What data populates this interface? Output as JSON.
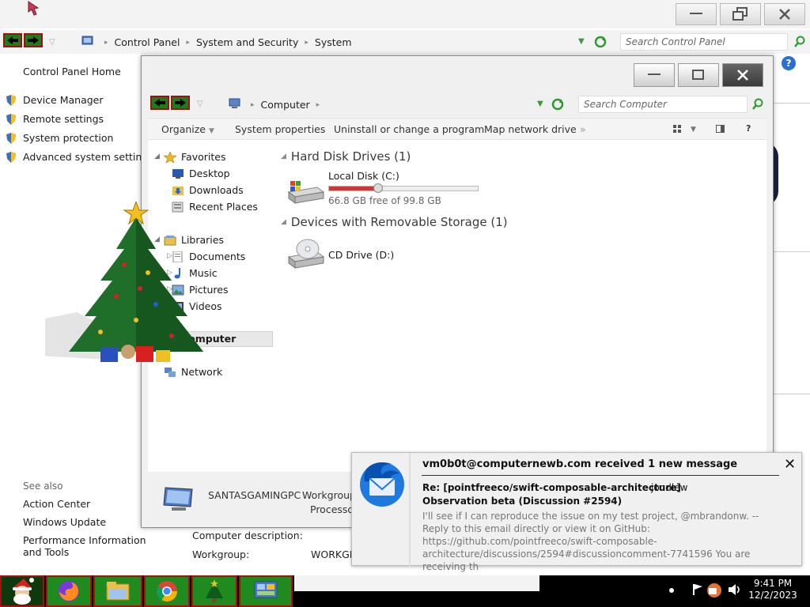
{
  "control_panel": {
    "breadcrumb": [
      "Control Panel",
      "System and Security",
      "System"
    ],
    "search_placeholder": "Search Control Panel",
    "home_link": "Control Panel Home",
    "tasks": [
      "Device Manager",
      "Remote settings",
      "System protection",
      "Advanced system settings"
    ],
    "see_also_label": "See also",
    "see_also": [
      "Action Center",
      "Windows Update",
      "Performance Information and Tools"
    ],
    "computer_description_label": "Computer description:",
    "workgroup_label": "Workgroup:",
    "workgroup_value": "WORKGR"
  },
  "explorer": {
    "location": "Computer",
    "search_placeholder": "Search Computer",
    "toolbar": [
      "Organize",
      "System properties",
      "Uninstall or change a program",
      "Map network drive"
    ],
    "help_label": "?",
    "nav": {
      "favorites": "Favorites",
      "favorites_items": [
        "Desktop",
        "Downloads",
        "Recent Places"
      ],
      "libraries": "Libraries",
      "libraries_items": [
        "Documents",
        "Music",
        "Pictures",
        "Videos"
      ],
      "computer": "Computer",
      "network": "Network"
    },
    "groups": {
      "hdd_title": "Hard Disk Drives (1)",
      "removable_title": "Devices with Removable Storage (1)"
    },
    "drives": {
      "c_name": "Local Disk (C:)",
      "c_free": "66.8 GB free of 99.8 GB",
      "c_used_fraction": 0.33,
      "d_name": "CD Drive (D:)"
    },
    "details": {
      "computer_name": "SANTASGAMINGPC",
      "workgroup": "Workgroup",
      "processor": "Processor"
    }
  },
  "notification": {
    "header": "vm0b0t@computernewb.com received 1 new message",
    "subject_line1": "Re: [pointfreeco/swift-composable-architecture]",
    "sender": "jondlew",
    "subject_line2": "Observation beta (Discussion #2594)",
    "body": "I'll see if I can reproduce the issue on my test project, @mbrandonw. -- Reply to this email directly or view it on GitHub: https://github.com/pointfreeco/swift-composable-architecture/discussions/2594#discussioncomment-7741596 You are receiving th",
    "close": "✕"
  },
  "taskbar": {
    "time": "9:41 PM",
    "date": "12/2/2023",
    "apps": [
      "start-santa",
      "firefox",
      "file-explorer",
      "chrome",
      "christmas-tree-app",
      "control-panel-app"
    ]
  },
  "colors": {
    "nav_green": "#1d7d1d",
    "nav_border": "#a01010",
    "usage_red": "#c73a3a",
    "thunderbird_blue": "#1f7ae0"
  }
}
